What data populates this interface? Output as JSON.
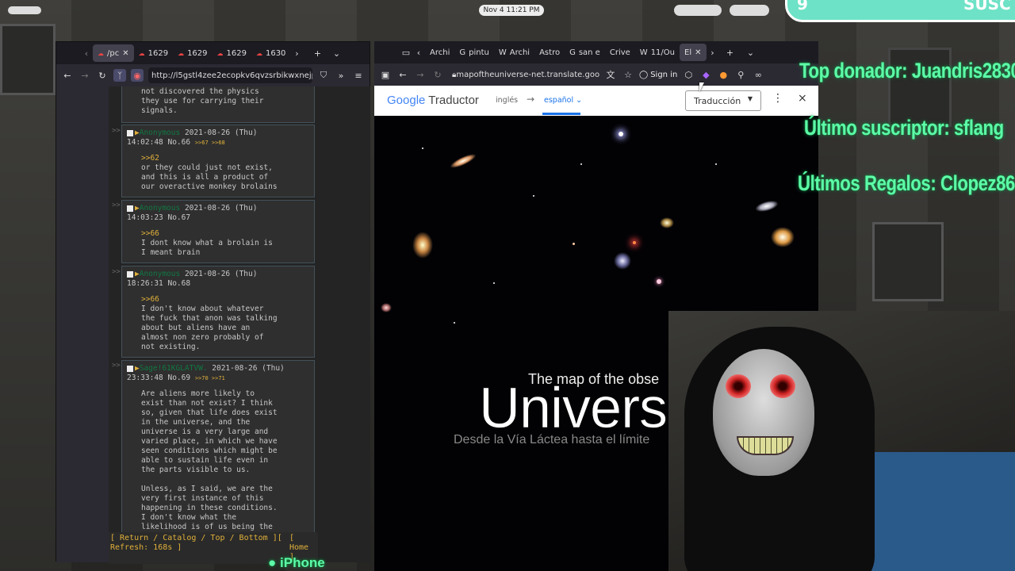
{
  "system": {
    "clock": "Nov 4  11:21 PM"
  },
  "overlay": {
    "subs_number": "9",
    "subs_word": "SUSC",
    "top_donor": "Top donador: Juandris2830",
    "last_sub": "Último suscriptor: sflang",
    "last_gifts": "Últimos Regalos: Clopez86",
    "iphone": "iPhone"
  },
  "left_browser": {
    "tabs": [
      "/pc",
      "1629",
      "1629",
      "1629",
      "1630"
    ],
    "url": "http://l5gstl4zee2ecopkv6qvzsrbikwxnejp",
    "partial_text": "not discovered the physics\nthey use for carrying their\nsignals.",
    "posts": [
      {
        "name": "Anonymous",
        "date": "2021-08-26 (Thu)",
        "time": "14:02:48 No.66",
        "refs": ">>67 >>68",
        "quote": ">>62",
        "body": "or they could just not exist,\nand this is all a product of\nour overactive monkey brolains"
      },
      {
        "name": "Anonymous",
        "date": "2021-08-26 (Thu)",
        "time": "14:03:23 No.67",
        "refs": "",
        "quote": ">>66",
        "body": "I dont know what a brolain is\nI meant brain"
      },
      {
        "name": "Anonymous",
        "date": "2021-08-26 (Thu)",
        "time": "18:26:31 No.68",
        "refs": "",
        "quote": ">>66",
        "body": "I don't know about whatever\nthe fuck that anon was talking\nabout but aliens have an\nalmost non zero probably of\nnot existing."
      },
      {
        "name": "Sage!61KGLATVW.",
        "date": "2021-08-26 (Thu)",
        "time": "23:33:48 No.69",
        "refs": ">>70 >>71",
        "quote": "",
        "body": "Are aliens more likely to\nexist than not exist? I think\nso, given that life does exist\nin the universe, and the\nuniverse is a very large and\nvaried place, in which we have\nseen conditions which might be\nable to sustain life even in\nthe parts visible to us.\n\nUnless, as I said, we are the\nvery first instance of this\nhappening in these conditions.\nI don't know what the\nlikelihood is of us being the"
      }
    ],
    "footer_line1": "[ Return / Catalog / Top / Bottom ][",
    "footer_home": "[\nHome\n]",
    "footer_refresh": "Refresh: 168s ]"
  },
  "right_browser": {
    "tabs": [
      "Archi",
      "pintu",
      "Archi",
      "Astro",
      "san e",
      "Crive",
      "11/Ou",
      "El"
    ],
    "url": "mapoftheuniverse-net.translate.goog",
    "sign_in": "Sign in",
    "translate": {
      "logo_google": "Google",
      "logo_translator": "Traductor",
      "source_lang": "inglés",
      "arrow": "→",
      "target_lang": "español",
      "mode": "Traducción"
    },
    "page": {
      "subtitle": "The map of the obse",
      "title": "Univers",
      "description": "Desde la Vía Láctea hasta el límite"
    }
  }
}
